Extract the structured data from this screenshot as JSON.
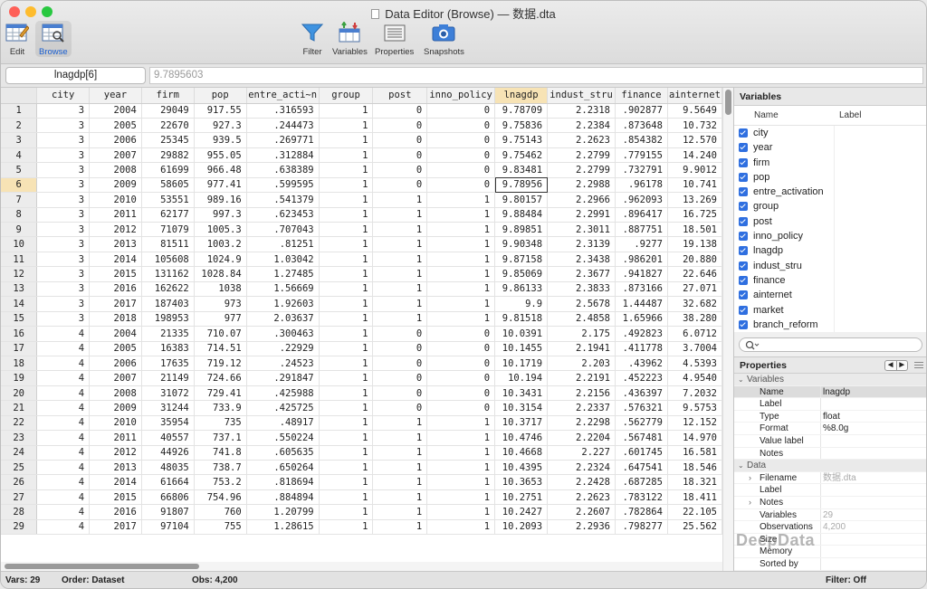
{
  "window": {
    "title": "Data Editor (Browse) — 数据.dta",
    "colors": {
      "close": "#fe5f57",
      "minimize": "#febc2e",
      "zoom": "#28c840",
      "selected_header": "#f7e3b5",
      "checkbox": "#2f6fe0"
    }
  },
  "toolbar": {
    "edit": "Edit",
    "browse": "Browse",
    "filter": "Filter",
    "variables": "Variables",
    "properties": "Properties",
    "snapshots": "Snapshots"
  },
  "cellbar": {
    "name": "lnagdp[6]",
    "value": "9.7895603"
  },
  "grid": {
    "columns": [
      "city",
      "year",
      "firm",
      "pop",
      "entre_acti~n",
      "group",
      "post",
      "inno_policy",
      "lnagdp",
      "indust_stru",
      "finance",
      "ainternet"
    ],
    "selected_column": "lnagdp",
    "selected_row": "6",
    "rows": [
      [
        "1",
        "3",
        "2004",
        "29049",
        "917.55",
        ".316593",
        "1",
        "0",
        "0",
        "9.78709",
        "2.2318",
        ".902877",
        "9.5649"
      ],
      [
        "2",
        "3",
        "2005",
        "22670",
        "927.3",
        ".244473",
        "1",
        "0",
        "0",
        "9.75836",
        "2.2384",
        ".873648",
        "10.732"
      ],
      [
        "3",
        "3",
        "2006",
        "25345",
        "939.5",
        ".269771",
        "1",
        "0",
        "0",
        "9.75143",
        "2.2623",
        ".854382",
        "12.570"
      ],
      [
        "4",
        "3",
        "2007",
        "29882",
        "955.05",
        ".312884",
        "1",
        "0",
        "0",
        "9.75462",
        "2.2799",
        ".779155",
        "14.240"
      ],
      [
        "5",
        "3",
        "2008",
        "61699",
        "966.48",
        ".638389",
        "1",
        "0",
        "0",
        "9.83481",
        "2.2799",
        ".732791",
        "9.9012"
      ],
      [
        "6",
        "3",
        "2009",
        "58605",
        "977.41",
        ".599595",
        "1",
        "0",
        "0",
        "9.78956",
        "2.2988",
        ".96178",
        "10.741"
      ],
      [
        "7",
        "3",
        "2010",
        "53551",
        "989.16",
        ".541379",
        "1",
        "1",
        "1",
        "9.80157",
        "2.2966",
        ".962093",
        "13.269"
      ],
      [
        "8",
        "3",
        "2011",
        "62177",
        "997.3",
        ".623453",
        "1",
        "1",
        "1",
        "9.88484",
        "2.2991",
        ".896417",
        "16.725"
      ],
      [
        "9",
        "3",
        "2012",
        "71079",
        "1005.3",
        ".707043",
        "1",
        "1",
        "1",
        "9.89851",
        "2.3011",
        ".887751",
        "18.501"
      ],
      [
        "10",
        "3",
        "2013",
        "81511",
        "1003.2",
        ".81251",
        "1",
        "1",
        "1",
        "9.90348",
        "2.3139",
        ".9277",
        "19.138"
      ],
      [
        "11",
        "3",
        "2014",
        "105608",
        "1024.9",
        "1.03042",
        "1",
        "1",
        "1",
        "9.87158",
        "2.3438",
        ".986201",
        "20.880"
      ],
      [
        "12",
        "3",
        "2015",
        "131162",
        "1028.84",
        "1.27485",
        "1",
        "1",
        "1",
        "9.85069",
        "2.3677",
        ".941827",
        "22.646"
      ],
      [
        "13",
        "3",
        "2016",
        "162622",
        "1038",
        "1.56669",
        "1",
        "1",
        "1",
        "9.86133",
        "2.3833",
        ".873166",
        "27.071"
      ],
      [
        "14",
        "3",
        "2017",
        "187403",
        "973",
        "1.92603",
        "1",
        "1",
        "1",
        "9.9",
        "2.5678",
        "1.44487",
        "32.682"
      ],
      [
        "15",
        "3",
        "2018",
        "198953",
        "977",
        "2.03637",
        "1",
        "1",
        "1",
        "9.81518",
        "2.4858",
        "1.65966",
        "38.280"
      ],
      [
        "16",
        "4",
        "2004",
        "21335",
        "710.07",
        ".300463",
        "1",
        "0",
        "0",
        "10.0391",
        "2.175",
        ".492823",
        "6.0712"
      ],
      [
        "17",
        "4",
        "2005",
        "16383",
        "714.51",
        ".22929",
        "1",
        "0",
        "0",
        "10.1455",
        "2.1941",
        ".411778",
        "3.7004"
      ],
      [
        "18",
        "4",
        "2006",
        "17635",
        "719.12",
        ".24523",
        "1",
        "0",
        "0",
        "10.1719",
        "2.203",
        ".43962",
        "4.5393"
      ],
      [
        "19",
        "4",
        "2007",
        "21149",
        "724.66",
        ".291847",
        "1",
        "0",
        "0",
        "10.194",
        "2.2191",
        ".452223",
        "4.9540"
      ],
      [
        "20",
        "4",
        "2008",
        "31072",
        "729.41",
        ".425988",
        "1",
        "0",
        "0",
        "10.3431",
        "2.2156",
        ".436397",
        "7.2032"
      ],
      [
        "21",
        "4",
        "2009",
        "31244",
        "733.9",
        ".425725",
        "1",
        "0",
        "0",
        "10.3154",
        "2.2337",
        ".576321",
        "9.5753"
      ],
      [
        "22",
        "4",
        "2010",
        "35954",
        "735",
        ".48917",
        "1",
        "1",
        "1",
        "10.3717",
        "2.2298",
        ".562779",
        "12.152"
      ],
      [
        "23",
        "4",
        "2011",
        "40557",
        "737.1",
        ".550224",
        "1",
        "1",
        "1",
        "10.4746",
        "2.2204",
        ".567481",
        "14.970"
      ],
      [
        "24",
        "4",
        "2012",
        "44926",
        "741.8",
        ".605635",
        "1",
        "1",
        "1",
        "10.4668",
        "2.227",
        ".601745",
        "16.581"
      ],
      [
        "25",
        "4",
        "2013",
        "48035",
        "738.7",
        ".650264",
        "1",
        "1",
        "1",
        "10.4395",
        "2.2324",
        ".647541",
        "18.546"
      ],
      [
        "26",
        "4",
        "2014",
        "61664",
        "753.2",
        ".818694",
        "1",
        "1",
        "1",
        "10.3653",
        "2.2428",
        ".687285",
        "18.321"
      ],
      [
        "27",
        "4",
        "2015",
        "66806",
        "754.96",
        ".884894",
        "1",
        "1",
        "1",
        "10.2751",
        "2.2623",
        ".783122",
        "18.411"
      ],
      [
        "28",
        "4",
        "2016",
        "91807",
        "760",
        "1.20799",
        "1",
        "1",
        "1",
        "10.2427",
        "2.2607",
        ".782864",
        "22.105"
      ],
      [
        "29",
        "4",
        "2017",
        "97104",
        "755",
        "1.28615",
        "1",
        "1",
        "1",
        "10.2093",
        "2.2936",
        ".798277",
        "25.562"
      ]
    ]
  },
  "variables_panel": {
    "title": "Variables",
    "col_name": "Name",
    "col_label": "Label",
    "items": [
      "city",
      "year",
      "firm",
      "pop",
      "entre_activation",
      "group",
      "post",
      "inno_policy",
      "lnagdp",
      "indust_stru",
      "finance",
      "ainternet",
      "market",
      "branch_reform"
    ]
  },
  "properties_panel": {
    "title": "Properties",
    "variables_group": "Variables",
    "variables": [
      {
        "k": "Name",
        "v": "lnagdp"
      },
      {
        "k": "Label",
        "v": ""
      },
      {
        "k": "Type",
        "v": "float"
      },
      {
        "k": "Format",
        "v": "%8.0g"
      },
      {
        "k": "Value label",
        "v": ""
      },
      {
        "k": "Notes",
        "v": ""
      }
    ],
    "data_group": "Data",
    "data": [
      {
        "k": "Filename",
        "v": "数据.dta",
        "arrow": true
      },
      {
        "k": "Label",
        "v": ""
      },
      {
        "k": "Notes",
        "v": "",
        "arrow": true
      },
      {
        "k": "Variables",
        "v": "29"
      },
      {
        "k": "Observations",
        "v": "4,200"
      },
      {
        "k": "Size",
        "v": ""
      },
      {
        "k": "Memory",
        "v": ""
      },
      {
        "k": "Sorted by",
        "v": ""
      }
    ]
  },
  "status": {
    "vars": "Vars: 29",
    "order": "Order: Dataset",
    "obs": "Obs: 4,200",
    "filter": "Filter: Off"
  },
  "watermark": "DeepData"
}
